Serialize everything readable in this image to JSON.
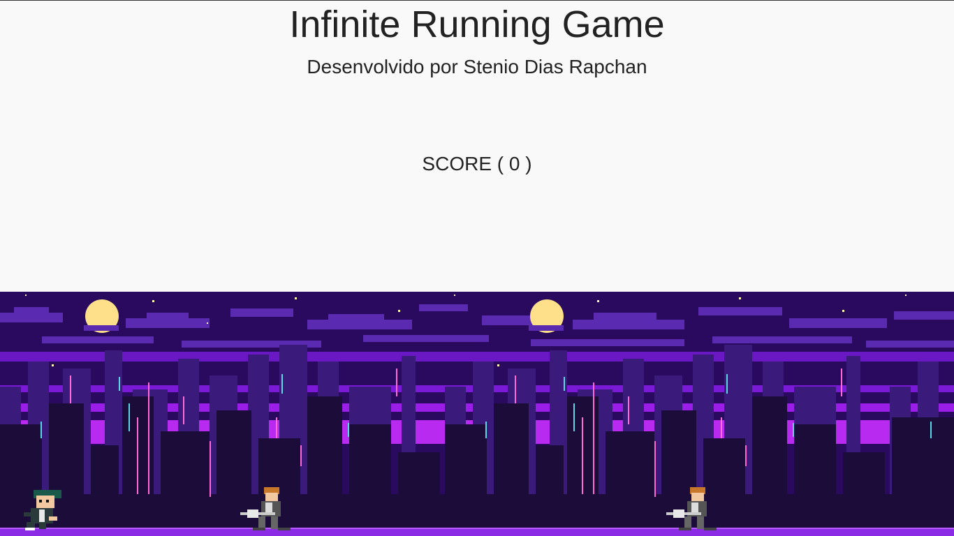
{
  "header": {
    "title": "Infinite Running Game",
    "subtitle": "Desenvolvido por Stenio Dias Rapchan"
  },
  "score": {
    "label": "SCORE ( 0 )",
    "value": 0
  },
  "game": {
    "background": "night-city-skyline",
    "colors": {
      "sky": "#2a0a5e",
      "cloud": "#5a2bb0",
      "moon": "#ffe08a",
      "buildings_far": "#3a1a7a",
      "buildings_near": "#1c0c3a",
      "neon_band": "#9a1ee8",
      "ground": "#8b2be6",
      "window_cyan": "#5ad8e8",
      "window_pink": "#ff6ad5"
    },
    "player": {
      "name": "player-character",
      "icon": "runner-sprite"
    },
    "obstacles": [
      {
        "name": "guitarist-enemy",
        "icon": "guitar-player-sprite"
      },
      {
        "name": "guitarist-enemy",
        "icon": "guitar-player-sprite"
      }
    ]
  }
}
